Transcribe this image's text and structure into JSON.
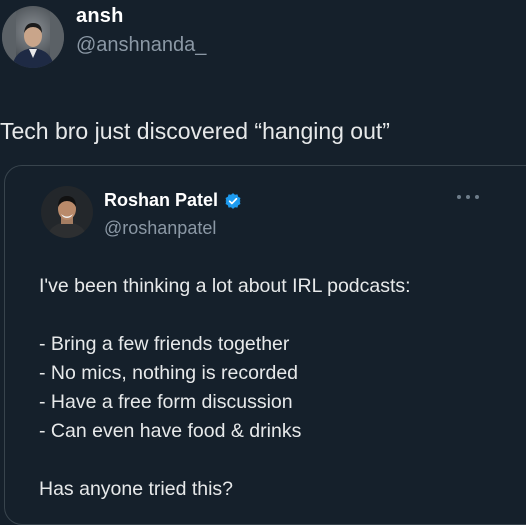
{
  "tweet": {
    "author_name": "ansh",
    "author_handle": "@anshnanda_",
    "text": "Tech bro just discovered “hanging out”"
  },
  "quoted_tweet": {
    "author_name": "Roshan Patel",
    "author_handle": "@roshanpatel",
    "verified": true,
    "body_lines": [
      "I've been thinking a lot about IRL podcasts:",
      "- Bring a few friends together",
      "- No mics, nothing is recorded",
      "- Have a free form discussion",
      "- Can even have food & drinks",
      "Has anyone tried this?"
    ]
  },
  "colors": {
    "background": "#15202b",
    "text_primary": "#e7e9ea",
    "text_secondary": "#8b98a5",
    "border": "#38444d",
    "verified_blue": "#1d9bf0"
  },
  "icons": [
    "avatar",
    "verified-badge-icon",
    "more-options-icon"
  ]
}
